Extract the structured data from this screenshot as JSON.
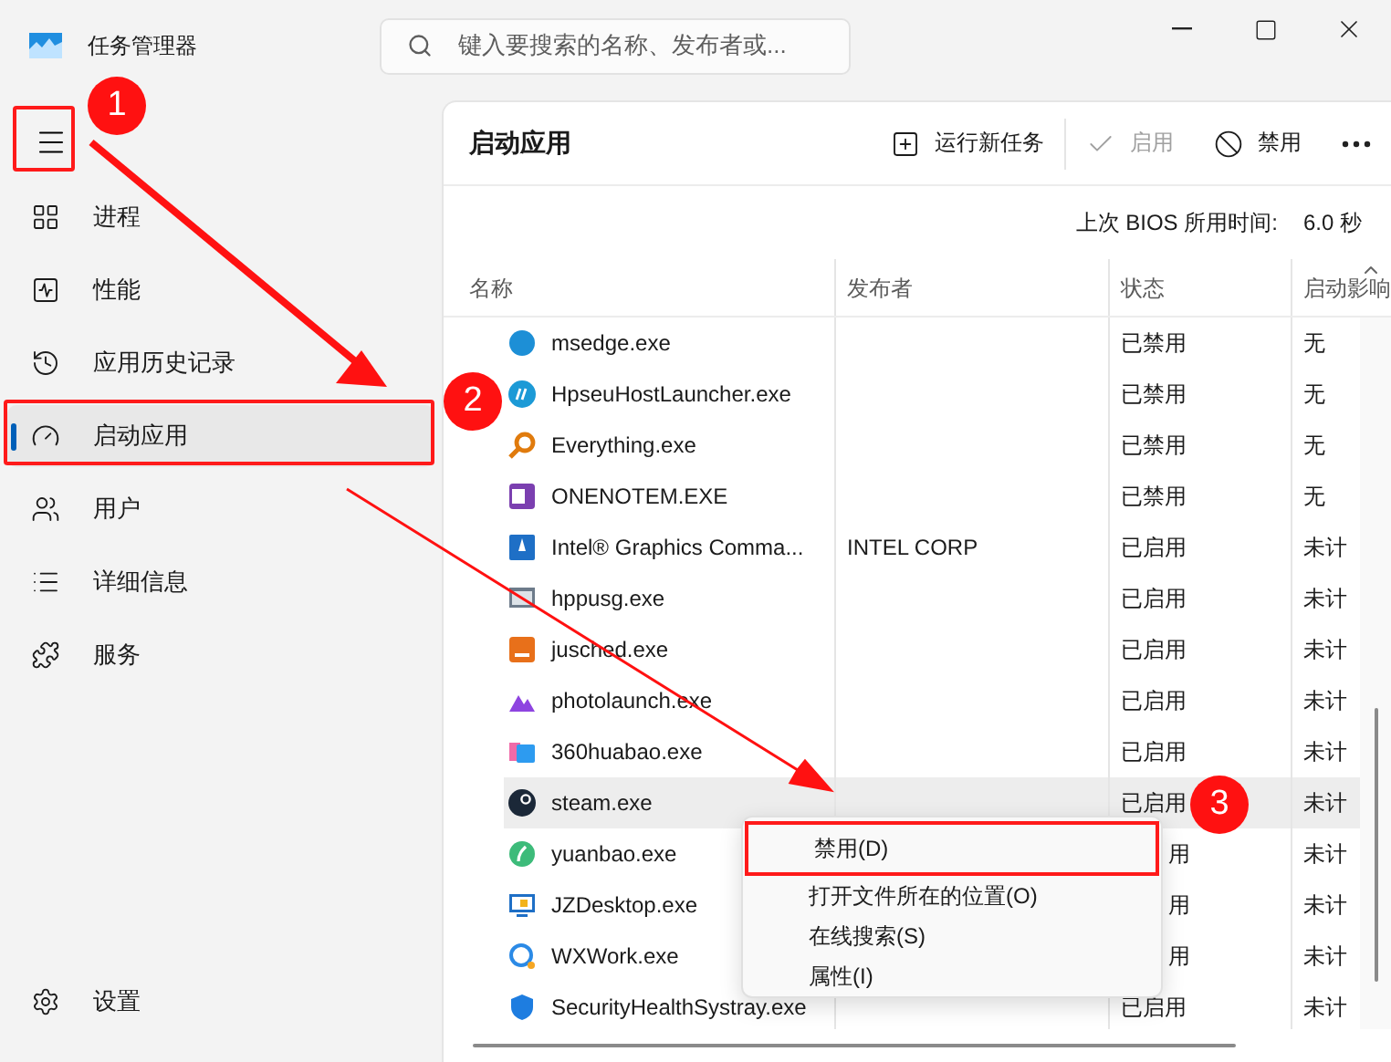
{
  "window": {
    "title": "任务管理器"
  },
  "search": {
    "placeholder": "键入要搜索的名称、发布者或..."
  },
  "sidebar": {
    "items": [
      {
        "label": "进程",
        "selected": false
      },
      {
        "label": "性能",
        "selected": false
      },
      {
        "label": "应用历史记录",
        "selected": false
      },
      {
        "label": "启动应用",
        "selected": true
      },
      {
        "label": "用户",
        "selected": false
      },
      {
        "label": "详细信息",
        "selected": false
      },
      {
        "label": "服务",
        "selected": false
      }
    ],
    "footer": "设置"
  },
  "page": {
    "title": "启动应用",
    "toolbar": [
      {
        "label": "运行新任务",
        "disabled": false
      },
      {
        "label": "启用",
        "disabled": true
      },
      {
        "label": "禁用",
        "disabled": false
      }
    ],
    "bios_label": "上次 BIOS 所用时间:",
    "bios_value": "6.0 秒"
  },
  "table": {
    "columns": [
      "名称",
      "发布者",
      "状态",
      "启动影响"
    ],
    "rows": [
      {
        "name": "msedge.exe",
        "publisher": "",
        "status": "已禁用",
        "impact": "无",
        "selected": false,
        "obscured": false
      },
      {
        "name": "HpseuHostLauncher.exe",
        "publisher": "",
        "status": "已禁用",
        "impact": "无",
        "selected": false,
        "obscured": false
      },
      {
        "name": "Everything.exe",
        "publisher": "",
        "status": "已禁用",
        "impact": "无",
        "selected": false,
        "obscured": false
      },
      {
        "name": "ONENOTEM.EXE",
        "publisher": "",
        "status": "已禁用",
        "impact": "无",
        "selected": false,
        "obscured": false
      },
      {
        "name": "Intel® Graphics Comma...",
        "publisher": "INTEL CORP",
        "status": "已启用",
        "impact": "未计",
        "selected": false,
        "obscured": false
      },
      {
        "name": "hppusg.exe",
        "publisher": "",
        "status": "已启用",
        "impact": "未计",
        "selected": false,
        "obscured": false
      },
      {
        "name": "jusched.exe",
        "publisher": "",
        "status": "已启用",
        "impact": "未计",
        "selected": false,
        "obscured": false
      },
      {
        "name": "photolaunch.exe",
        "publisher": "",
        "status": "已启用",
        "impact": "未计",
        "selected": false,
        "obscured": false
      },
      {
        "name": "360huabao.exe",
        "publisher": "",
        "status": "已启用",
        "impact": "未计",
        "selected": false,
        "obscured": false
      },
      {
        "name": "steam.exe",
        "publisher": "",
        "status": "已启用",
        "impact": "未计",
        "selected": true,
        "obscured": false
      },
      {
        "name": "yuanbao.exe",
        "publisher": "",
        "status": "用",
        "impact": "未计",
        "selected": false,
        "obscured": true
      },
      {
        "name": "JZDesktop.exe",
        "publisher": "",
        "status": "用",
        "impact": "未计",
        "selected": false,
        "obscured": true
      },
      {
        "name": "WXWork.exe",
        "publisher": "",
        "status": "用",
        "impact": "未计",
        "selected": false,
        "obscured": true
      },
      {
        "name": "SecurityHealthSystray.exe",
        "publisher": "",
        "status": "已启用",
        "impact": "未计",
        "selected": false,
        "obscured": false
      }
    ]
  },
  "context_menu": {
    "items": [
      {
        "label": "禁用(D)",
        "highlighted": true
      },
      {
        "label": "打开文件所在的位置(O)",
        "highlighted": false
      },
      {
        "label": "在线搜索(S)",
        "highlighted": false
      },
      {
        "label": "属性(I)",
        "highlighted": false
      }
    ]
  },
  "annotations": {
    "steps": [
      "1",
      "2",
      "3"
    ]
  }
}
